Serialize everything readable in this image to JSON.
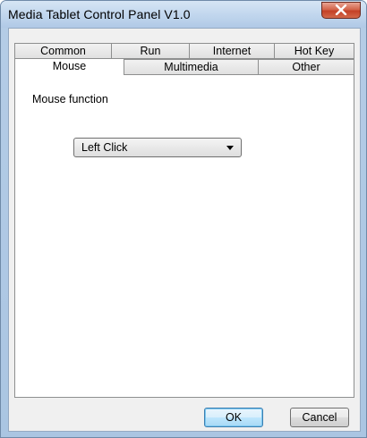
{
  "window": {
    "title": "Media Tablet Control Panel V1.0"
  },
  "tabs": {
    "row1": [
      {
        "id": "common",
        "label": "Common"
      },
      {
        "id": "run",
        "label": "Run"
      },
      {
        "id": "internet",
        "label": "Internet"
      },
      {
        "id": "hotkey",
        "label": "Hot Key"
      }
    ],
    "row2": [
      {
        "id": "mouse",
        "label": "Mouse",
        "active": true
      },
      {
        "id": "multimedia",
        "label": "Multimedia"
      },
      {
        "id": "other",
        "label": "Other"
      }
    ]
  },
  "mouse": {
    "function_label": "Mouse function",
    "function_value": "Left Click"
  },
  "buttons": {
    "ok": "OK",
    "cancel": "Cancel"
  },
  "icons": {
    "close": "close-icon",
    "dropdown": "chevron-down-icon"
  },
  "colors": {
    "title_bar": "#c2d7ee",
    "close_button": "#c44126",
    "default_button_border": "#3c7fb1"
  }
}
